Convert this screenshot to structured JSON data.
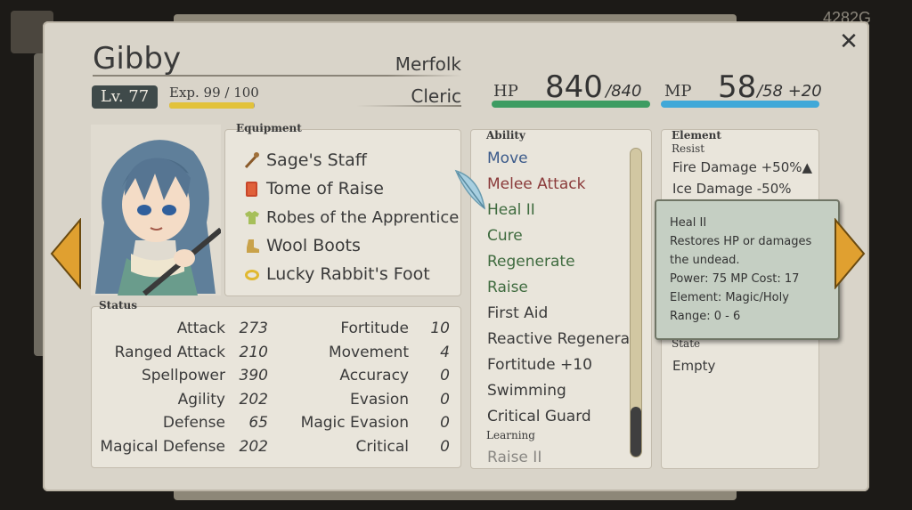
{
  "background": {
    "gold": "4282G"
  },
  "character": {
    "name": "Gibby",
    "race": "Merfolk",
    "class": "Cleric",
    "level_label": "Lv. 77",
    "exp_label": "Exp. 99 / 100",
    "exp_fraction": 0.99,
    "hp_label": "HP",
    "hp_value": "840",
    "hp_max": "/840",
    "mp_label": "MP",
    "mp_value": "58",
    "mp_max": "/58",
    "mp_bonus": "+20"
  },
  "equipment": {
    "label": "Equipment",
    "items": [
      {
        "name": "Sage's Staff",
        "icon": "staff-icon"
      },
      {
        "name": "Tome of Raise",
        "icon": "book-icon"
      },
      {
        "name": "Robes of the Apprentice",
        "icon": "robe-icon"
      },
      {
        "name": "Wool Boots",
        "icon": "boot-icon"
      },
      {
        "name": "Lucky Rabbit's Foot",
        "icon": "ring-icon"
      }
    ]
  },
  "status": {
    "label": "Status",
    "left": [
      {
        "name": "Attack",
        "value": "273"
      },
      {
        "name": "Ranged Attack",
        "value": "210"
      },
      {
        "name": "Spellpower",
        "value": "390"
      },
      {
        "name": "Agility",
        "value": "202"
      },
      {
        "name": "Defense",
        "value": "65"
      },
      {
        "name": "Magical Defense",
        "value": "202"
      }
    ],
    "right": [
      {
        "name": "Fortitude",
        "value": "10"
      },
      {
        "name": "Movement",
        "value": "4"
      },
      {
        "name": "Accuracy",
        "value": "0"
      },
      {
        "name": "Evasion",
        "value": "0"
      },
      {
        "name": "Magic Evasion",
        "value": "0"
      },
      {
        "name": "Critical",
        "value": "0"
      }
    ]
  },
  "ability": {
    "label": "Ability",
    "items": [
      {
        "name": "Move",
        "color": "#3b5a8a"
      },
      {
        "name": "Melee Attack",
        "color": "#8a3a3a"
      },
      {
        "name": "Heal II",
        "color": "#3f6b3f"
      },
      {
        "name": "Cure",
        "color": "#3f6b3f"
      },
      {
        "name": "Regenerate",
        "color": "#3f6b3f"
      },
      {
        "name": "Raise",
        "color": "#3f6b3f"
      },
      {
        "name": "First Aid",
        "color": "#3a3a3a"
      },
      {
        "name": "Reactive Regenerat",
        "color": "#3a3a3a"
      },
      {
        "name": "Fortitude +10",
        "color": "#3a3a3a"
      },
      {
        "name": "Swimming",
        "color": "#3a3a3a"
      },
      {
        "name": "Critical Guard",
        "color": "#3a3a3a"
      }
    ],
    "learning_label": "Learning",
    "learning_items": [
      "Raise II"
    ]
  },
  "element": {
    "label": "Element",
    "resist_label": "Resist",
    "resist_items": [
      "Fire Damage +50%▲",
      "Ice Damage -50%"
    ],
    "state_label": "State",
    "state_value": "Empty"
  },
  "tooltip": {
    "title": "Heal II",
    "desc1": "Restores HP or damages",
    "desc2": "the undead.",
    "power": "Power: 75  MP Cost: 17",
    "element": "Element: Magic/Holy",
    "range": "Range: 0 - 6"
  },
  "close_icon": "✕"
}
